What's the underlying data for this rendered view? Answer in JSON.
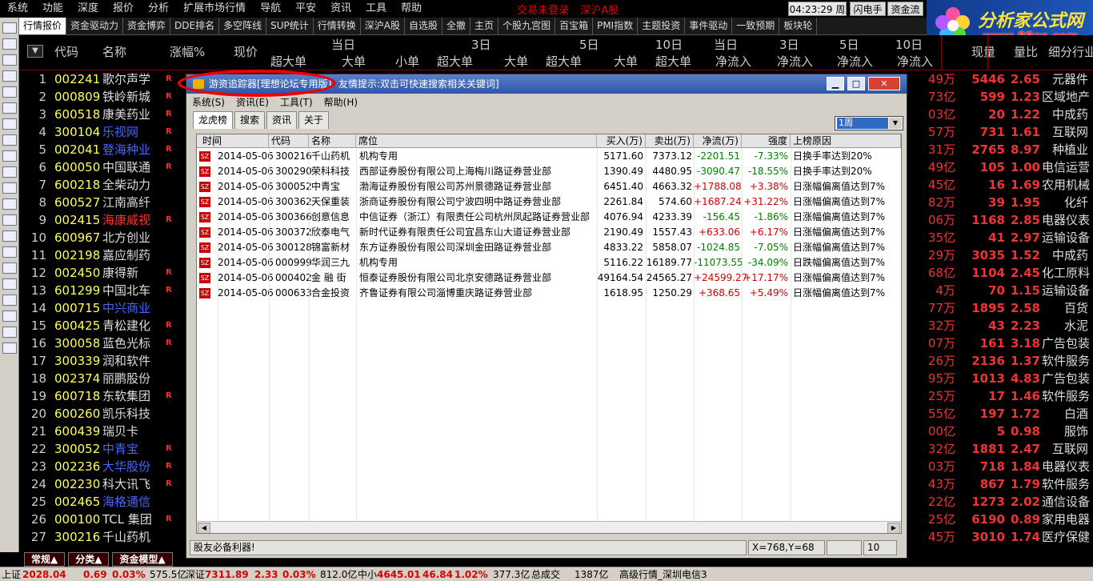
{
  "menu": {
    "items": [
      "系统",
      "功能",
      "深度",
      "报价",
      "分析",
      "扩展市场行情",
      "导航",
      "平安",
      "资讯",
      "工具",
      "帮助"
    ],
    "status_warn_1": "交易未登录",
    "status_warn_2": "深沪A股",
    "clock": "04:23:29 周三",
    "flash_btn": "闪电手",
    "fund_btn": "资金流"
  },
  "logo": {
    "title": "分析家公式网",
    "url": "www.88gs.com"
  },
  "tabbar": [
    "行情报价",
    "资金驱动力",
    "资金博弈",
    "DDE排名",
    "多空阵线",
    "SUP统计",
    "行情转换",
    "深沪A股",
    "自选股",
    "全撤",
    "主页",
    "个股九宫图",
    "百宝箱",
    "PMI指数",
    "主题投资",
    "事件驱动",
    "一致预期",
    "板块轮"
  ],
  "header": {
    "code": "代码",
    "name": "名称",
    "change": "涨幅%",
    "price": "现价",
    "g1": "当日",
    "g2": "3日",
    "g3": "5日",
    "g4": "10日",
    "g5": "当日",
    "g6": "3日",
    "g7": "5日",
    "g8": "10日",
    "s1": "超大单",
    "s2": "大单",
    "s3": "小单",
    "s4": "超大单",
    "s5": "大单",
    "s6": "超大单",
    "s7": "大单",
    "s8": "超大单",
    "s9": "净流入",
    "s10": "净流入",
    "s11": "净流入",
    "s12": "净流入",
    "volume": "现量",
    "ratio": "量比",
    "industry": "细分行业"
  },
  "rows": [
    {
      "idx": "1",
      "code": "002241",
      "name": "歌尔声学",
      "flag": "R",
      "a": "49万",
      "b": "5446",
      "c": "2.65",
      "d": "元器件"
    },
    {
      "idx": "2",
      "code": "000809",
      "name": "铁岭新城",
      "flag": "R",
      "a": "73亿",
      "b": "599",
      "c": "1.23",
      "d": "区域地产"
    },
    {
      "idx": "3",
      "code": "600518",
      "name": "康美药业",
      "flag": "R",
      "a": "03亿",
      "b": "20",
      "c": "1.22",
      "d": "中成药"
    },
    {
      "idx": "4",
      "code": "300104",
      "name": "乐视网",
      "flag": "R",
      "a": "57万",
      "b": "731",
      "c": "1.61",
      "d": "互联网"
    },
    {
      "idx": "5",
      "code": "002041",
      "name": "登海种业",
      "flag": "R",
      "a": "31万",
      "b": "2765",
      "c": "8.97",
      "d": "种植业"
    },
    {
      "idx": "6",
      "code": "600050",
      "name": "中国联通",
      "flag": "R",
      "a": "49亿",
      "b": "105",
      "c": "1.00",
      "d": "电信运营"
    },
    {
      "idx": "7",
      "code": "600218",
      "name": "全柴动力",
      "flag": "",
      "a": "45亿",
      "b": "16",
      "c": "1.69",
      "d": "农用机械"
    },
    {
      "idx": "8",
      "code": "600527",
      "name": "江南高纤",
      "flag": "",
      "a": "82万",
      "b": "39",
      "c": "1.95",
      "d": "化纤"
    },
    {
      "idx": "9",
      "code": "002415",
      "name": "海康威视",
      "flag": "R",
      "a": "06万",
      "b": "1168",
      "c": "2.85",
      "d": "电器仪表"
    },
    {
      "idx": "10",
      "code": "600967",
      "name": "北方创业",
      "flag": "",
      "a": "35亿",
      "b": "41",
      "c": "2.97",
      "d": "运输设备"
    },
    {
      "idx": "11",
      "code": "002198",
      "name": "嘉应制药",
      "flag": "",
      "a": "29万",
      "b": "3035",
      "c": "1.52",
      "d": "中成药"
    },
    {
      "idx": "12",
      "code": "002450",
      "name": "康得新",
      "flag": "R",
      "a": "68亿",
      "b": "1104",
      "c": "2.45",
      "d": "化工原料"
    },
    {
      "idx": "13",
      "code": "601299",
      "name": "中国北车",
      "flag": "R",
      "a": "4万",
      "b": "70",
      "c": "1.15",
      "d": "运输设备"
    },
    {
      "idx": "14",
      "code": "000715",
      "name": "中兴商业",
      "flag": "",
      "a": "77万",
      "b": "1895",
      "c": "2.58",
      "d": "百货"
    },
    {
      "idx": "15",
      "code": "600425",
      "name": "青松建化",
      "flag": "R",
      "a": "32万",
      "b": "43",
      "c": "2.23",
      "d": "水泥"
    },
    {
      "idx": "16",
      "code": "300058",
      "name": "蓝色光标",
      "flag": "R",
      "a": "07万",
      "b": "161",
      "c": "3.18",
      "d": "广告包装"
    },
    {
      "idx": "17",
      "code": "300339",
      "name": "润和软件",
      "flag": "",
      "a": "26万",
      "b": "2136",
      "c": "1.37",
      "d": "软件服务"
    },
    {
      "idx": "18",
      "code": "002374",
      "name": "丽鹏股份",
      "flag": "",
      "a": "95万",
      "b": "1013",
      "c": "4.83",
      "d": "广告包装"
    },
    {
      "idx": "19",
      "code": "600718",
      "name": "东软集团",
      "flag": "R",
      "a": "25万",
      "b": "17",
      "c": "1.46",
      "d": "软件服务"
    },
    {
      "idx": "20",
      "code": "600260",
      "name": "凯乐科技",
      "flag": "",
      "a": "55亿",
      "b": "197",
      "c": "1.72",
      "d": "白酒"
    },
    {
      "idx": "21",
      "code": "600439",
      "name": "瑞贝卡",
      "flag": "",
      "a": "00亿",
      "b": "5",
      "c": "0.98",
      "d": "服饰"
    },
    {
      "idx": "22",
      "code": "300052",
      "name": "中青宝",
      "flag": "R",
      "a": "32亿",
      "b": "1881",
      "c": "2.47",
      "d": "互联网"
    },
    {
      "idx": "23",
      "code": "002236",
      "name": "大华股份",
      "flag": "R",
      "a": "03万",
      "b": "718",
      "c": "1.84",
      "d": "电器仪表"
    },
    {
      "idx": "24",
      "code": "002230",
      "name": "科大讯飞",
      "flag": "R",
      "a": "43万",
      "b": "867",
      "c": "1.79",
      "d": "软件服务"
    },
    {
      "idx": "25",
      "code": "002465",
      "name": "海格通信",
      "flag": "",
      "a": "22亿",
      "b": "1273",
      "c": "2.02",
      "d": "通信设备"
    },
    {
      "idx": "26",
      "code": "000100",
      "name": "TCL 集团",
      "flag": "R",
      "a": "25亿",
      "b": "6190",
      "c": "0.89",
      "d": "家用电器"
    },
    {
      "idx": "27",
      "code": "300216",
      "name": "千山药机",
      "flag": "",
      "a": "45万",
      "b": "3010",
      "c": "1.74",
      "d": "医疗保健"
    }
  ],
  "name_colors": {
    "4": "#4466ff",
    "5": "#4466ff",
    "9": "#ff3030",
    "14": "#4466ff",
    "22": "#4466ff",
    "23": "#4466ff",
    "25": "#4466ff"
  },
  "bottom_tabs": [
    "常规▲",
    "分类▲",
    "资金模型▲"
  ],
  "statusbar": {
    "sh_label": "上证",
    "sh_index": "2028.04",
    "sh_chg": "0.69",
    "sh_pct": "0.03%",
    "sh_amt": "575.5亿",
    "sz_label": "深证",
    "sz_index": "7311.89",
    "sz_chg": "2.33",
    "sz_pct": "0.03%",
    "sz_amt": "812.0亿",
    "zx_label": "中小",
    "zx_index": "4645.01",
    "zx_chg": "46.84",
    "zx_pct": "1.02%",
    "zx_amt": "377.3亿",
    "total_label": "总成交",
    "total_amt": "1387亿",
    "feed": "高级行情_深圳电信3"
  },
  "popup": {
    "title": "游资追踪器[理想论坛专用版]",
    "tip": "友情提示:双击可快速搜索相关关键词]",
    "menu": [
      "系统(S)",
      "资讯(E)",
      "工具(T)",
      "帮助(H)"
    ],
    "tabs": [
      "龙虎榜",
      "搜索",
      "资讯",
      "关于"
    ],
    "period": "1周",
    "columns": [
      "时间",
      "代码",
      "名称",
      "席位",
      "买入(万)",
      "卖出(万)",
      "净流(万)",
      "强度",
      "上榜原因"
    ],
    "rows": [
      {
        "date": "2014-05-06",
        "code": "300216",
        "name": "千山药机",
        "seat": "机构专用",
        "buy": "5171.60",
        "sell": "7373.12",
        "net": "-2201.51",
        "pct": "-7.33%",
        "reason": "日换手率达到20%"
      },
      {
        "date": "2014-05-06",
        "code": "300290",
        "name": "荣科科技",
        "seat": "西部证券股份有限公司上海梅川路证券营业部",
        "buy": "1390.49",
        "sell": "4480.95",
        "net": "-3090.47",
        "pct": "-18.55%",
        "reason": "日换手率达到20%"
      },
      {
        "date": "2014-05-06",
        "code": "300052",
        "name": "中青宝",
        "seat": "渤海证券股份有限公司苏州景德路证券营业部",
        "buy": "6451.40",
        "sell": "4663.32",
        "net": "+1788.08",
        "pct": "+3.38%",
        "reason": "日涨幅偏离值达到7%"
      },
      {
        "date": "2014-05-06",
        "code": "300362",
        "name": "天保重装",
        "seat": "浙商证券股份有限公司宁波四明中路证券营业部",
        "buy": "2261.84",
        "sell": "574.60",
        "net": "+1687.24",
        "pct": "+31.22%",
        "reason": "日涨幅偏离值达到7%"
      },
      {
        "date": "2014-05-06",
        "code": "300366",
        "name": "创意信息",
        "seat": "中信证券（浙江）有限责任公司杭州凤起路证券营业部",
        "buy": "4076.94",
        "sell": "4233.39",
        "net": "-156.45",
        "pct": "-1.86%",
        "reason": "日涨幅偏离值达到7%"
      },
      {
        "date": "2014-05-06",
        "code": "300372",
        "name": "欣泰电气",
        "seat": "新时代证券有限责任公司宜昌东山大道证券营业部",
        "buy": "2190.49",
        "sell": "1557.43",
        "net": "+633.06",
        "pct": "+6.17%",
        "reason": "日涨幅偏离值达到7%"
      },
      {
        "date": "2014-05-06",
        "code": "300128",
        "name": "锦富新材",
        "seat": "东方证券股份有限公司深圳金田路证券营业部",
        "buy": "4833.22",
        "sell": "5858.07",
        "net": "-1024.85",
        "pct": "-7.05%",
        "reason": "日涨幅偏离值达到7%"
      },
      {
        "date": "2014-05-06",
        "code": "000999",
        "name": "华润三九",
        "seat": "机构专用",
        "buy": "5116.22",
        "sell": "16189.77",
        "net": "-11073.55",
        "pct": "-34.09%",
        "reason": "日跌幅偏离值达到7%"
      },
      {
        "date": "2014-05-06",
        "code": "000402",
        "name": "金 融 街",
        "seat": "恒泰证券股份有限公司北京安德路证券营业部",
        "buy": "49164.54",
        "sell": "24565.27",
        "net": "+24599.27",
        "pct": "+17.17%",
        "reason": "日涨幅偏离值达到7%"
      },
      {
        "date": "2014-05-06",
        "code": "000633",
        "name": "合金投资",
        "seat": "齐鲁证券有限公司淄博重庆路证券营业部",
        "buy": "1618.95",
        "sell": "1250.29",
        "net": "+368.65",
        "pct": "+5.49%",
        "reason": "日涨幅偏离值达到7%"
      }
    ],
    "status_left": "股友必备利器!",
    "status_coords": "X=768,Y=68",
    "status_count": "10"
  },
  "colors": {
    "up": "#d00000",
    "down": "#008000",
    "accent": "#ffff55"
  }
}
